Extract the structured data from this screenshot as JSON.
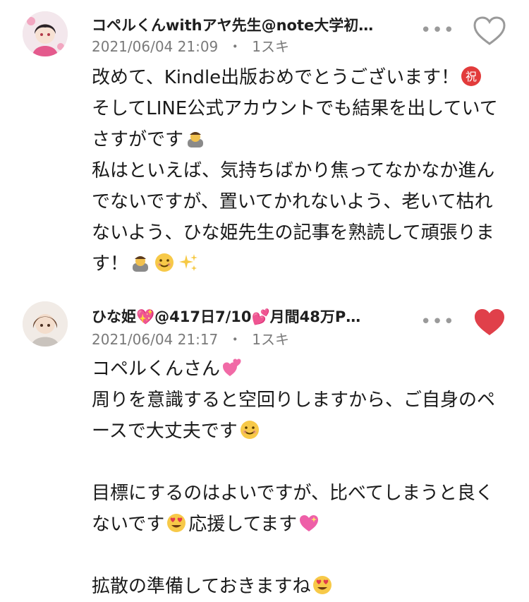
{
  "comments": [
    {
      "author": "コペルくんwithアヤ先生@note大学初…",
      "date": "2021/06/04 21:09",
      "separator": "・",
      "likes": "1スキ",
      "liked": false,
      "avatar": "anime-girl-avatar",
      "lines": [
        "改めて、Kindle出版おめでとうございます！",
        "そしてLINE公式アカウントでも結果を出していて",
        "さすがです",
        "私はといえば、気持ちばかり焦ってなかなか進ん",
        "でないですが、置いてかれないよう、老いて枯れ",
        "ないよう、ひな姫先生の記事を熟読して頑張りま",
        "す！"
      ]
    },
    {
      "author": "ひな姫💖@417日7/10💕月間48万P…",
      "date": "2021/06/04 21:17",
      "separator": "・",
      "likes": "1スキ",
      "liked": true,
      "avatar": "anime-girl-brown-hair-avatar",
      "lines": [
        "コペルくんさん",
        "周りを意識すると空回りしますから、ご自身のペ",
        "ースで大丈夫です",
        "",
        "目標にするのはよいですが、比べてしまうと良く",
        "ないです",
        "応援してます",
        "",
        "拡散の準備しておきますね"
      ]
    }
  ],
  "colors": {
    "heart_liked": "#e0404a",
    "heart_outline": "#9a9a9a",
    "meta": "#7a7a7a"
  },
  "icons": [
    "more-icon",
    "heart-icon",
    "bowing-emoji",
    "smile-emoji",
    "sparkles-emoji",
    "heart-eyes-emoji",
    "sparkling-heart-emoji",
    "two-hearts-emoji",
    "congratulations-emoji"
  ]
}
